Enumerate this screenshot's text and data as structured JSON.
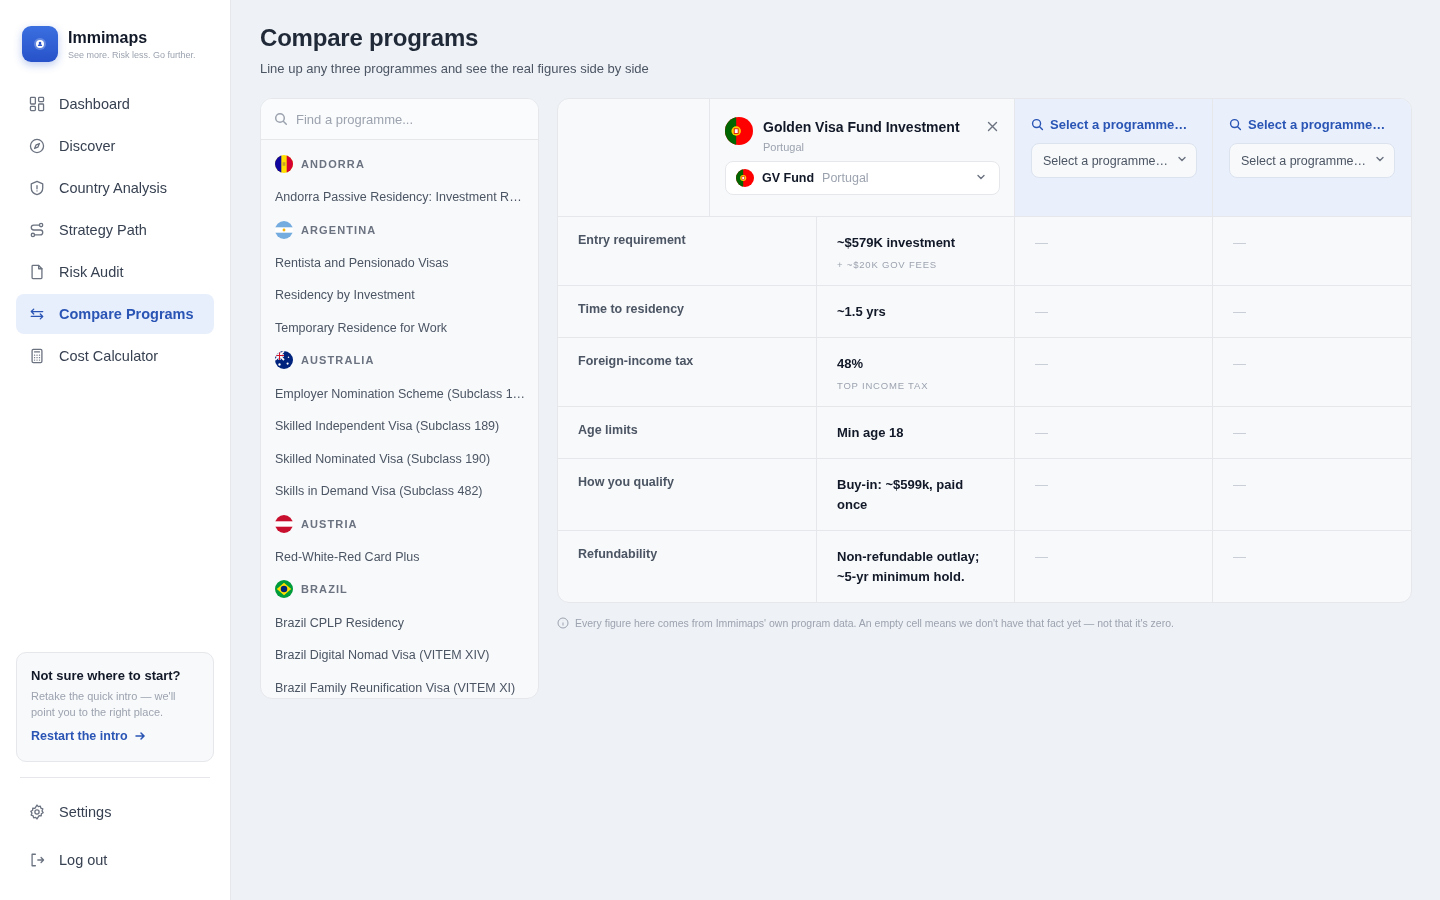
{
  "sidebar": {
    "brand": {
      "name": "Immimaps",
      "tagline": "See more. Risk less. Go further."
    },
    "nav": [
      {
        "label": "Dashboard",
        "selected": false
      },
      {
        "label": "Discover",
        "selected": false
      },
      {
        "label": "Country Analysis",
        "selected": false
      },
      {
        "label": "Strategy Path",
        "selected": false
      },
      {
        "label": "Risk Audit",
        "selected": false
      },
      {
        "label": "Compare Programs",
        "selected": true
      },
      {
        "label": "Cost Calculator",
        "selected": false
      }
    ],
    "help_card": {
      "title": "Not sure where to start?",
      "text": "Retake the quick intro — we'll point you to the right place.",
      "link": "Restart the intro"
    },
    "footer_nav": [
      {
        "label": "Settings"
      },
      {
        "label": "Log out"
      }
    ]
  },
  "page": {
    "title": "Compare programs",
    "subtitle": "Line up any three programmes and see the real figures side by side"
  },
  "program_list": {
    "search": {
      "placeholder": "Find a programme..."
    },
    "groups": [
      {
        "country": "ANDORRA",
        "programs": [
          "Andorra Passive Residency: Investment R…"
        ]
      },
      {
        "country": "ARGENTINA",
        "programs": [
          "Rentista and Pensionado Visas",
          "Residency by Investment",
          "Temporary Residence for Work"
        ]
      },
      {
        "country": "AUSTRALIA",
        "programs": [
          "Employer Nomination Scheme (Subclass 1…",
          "Skilled Independent Visa (Subclass 189)",
          "Skilled Nominated Visa (Subclass 190)",
          "Skills in Demand Visa (Subclass 482)"
        ]
      },
      {
        "country": "AUSTRIA",
        "programs": [
          "Red-White-Red Card Plus"
        ]
      },
      {
        "country": "BRAZIL",
        "programs": [
          "Brazil CPLP Residency",
          "Brazil Digital Nomad Visa (VITEM XIV)",
          "Brazil Family Reunification Visa (VITEM XI)"
        ]
      }
    ]
  },
  "compare": {
    "slots": [
      {
        "kind": "program",
        "name": "Golden Visa Fund Investment",
        "country": "Portugal",
        "select": {
          "value": "GV Fund",
          "country": "Portugal"
        }
      },
      {
        "kind": "empty",
        "heading": "Select a programme…",
        "placeholder": "Select a programme…"
      },
      {
        "kind": "empty",
        "heading": "Select a programme…",
        "placeholder": "Select a programme…"
      }
    ],
    "rows": [
      {
        "label": "Entry requirement",
        "cells": [
          {
            "text": "~$579K investment",
            "note": "+ ~$20K GOV FEES"
          },
          {
            "text": "—"
          },
          {
            "text": "—"
          }
        ]
      },
      {
        "label": "Time to residency",
        "cells": [
          {
            "text": "~1.5 yrs"
          },
          {
            "text": "—"
          },
          {
            "text": "—"
          }
        ]
      },
      {
        "label": "Foreign-income tax",
        "cells": [
          {
            "text": "48%",
            "note": "TOP INCOME TAX"
          },
          {
            "text": "—"
          },
          {
            "text": "—"
          }
        ]
      },
      {
        "label": "Age limits",
        "cells": [
          {
            "text": "Min age 18"
          },
          {
            "text": "—"
          },
          {
            "text": "—"
          }
        ]
      },
      {
        "label": "How you qualify",
        "cells": [
          {
            "text": "Buy-in: ~$599k, paid once"
          },
          {
            "text": "—"
          },
          {
            "text": "—"
          }
        ]
      },
      {
        "label": "Refundability",
        "cells": [
          {
            "text": "Non-refundable outlay; ~5-yr minimum hold."
          },
          {
            "text": "—"
          },
          {
            "text": "—"
          }
        ]
      }
    ],
    "footnote": "Every figure here comes from Immimaps' own program data. An empty cell means we don't have that fact yet — not that it's zero."
  }
}
